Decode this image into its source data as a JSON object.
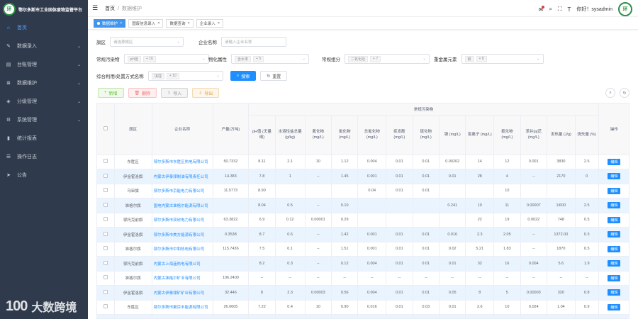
{
  "app": {
    "title": "鄂尔多斯市工业固体废物监管平台",
    "logo_text": "环",
    "watermark_logo": "100",
    "watermark_text": "大数跨境"
  },
  "sidebar": {
    "items": [
      {
        "label": "首页",
        "icon": "home-icon",
        "active": true
      },
      {
        "label": "数据录入",
        "icon": "edit-icon",
        "chevron": true
      },
      {
        "label": "台账管理",
        "icon": "ledger-icon",
        "chevron": true
      },
      {
        "label": "数据维护",
        "icon": "database-icon",
        "chevron": true
      },
      {
        "label": "分级管理",
        "icon": "layers-icon",
        "chevron": true
      },
      {
        "label": "系统管理",
        "icon": "gear-icon",
        "chevron": true
      },
      {
        "label": "统计报表",
        "icon": "bar-chart-icon"
      },
      {
        "label": "操作日志",
        "icon": "log-icon"
      },
      {
        "label": "公告",
        "icon": "send-icon"
      }
    ]
  },
  "header": {
    "breadcrumb": [
      "首页",
      "数据维护"
    ],
    "user": "你好！sysadmin",
    "avatar_text": "环"
  },
  "tags": [
    {
      "label": "数据维护",
      "active": true
    },
    {
      "label": "固废信息录入"
    },
    {
      "label": "数据查询"
    },
    {
      "label": "企业录入"
    }
  ],
  "filters": {
    "region_label": "旗区",
    "region_placeholder": "请选择旗区",
    "company_label": "企业名称",
    "company_placeholder": "请输入企业名称",
    "pollutant_label": "常规污染物",
    "pollutant_chips": [
      "pH值",
      "+ 16"
    ],
    "physchem_label": "物化属性",
    "physchem_chips": [
      "含水率",
      "+ 5"
    ],
    "conventional_label": "常规组分",
    "conventional_chips": [
      "二氧化硅",
      "+ 7"
    ],
    "heavy_label": "重金属元素",
    "heavy_chips": [
      "镉",
      "+ 8"
    ],
    "radio_label": "综合利用/处置方式名称",
    "radio_chips": [
      "填埋",
      "+ 10"
    ],
    "search_button": "搜索",
    "reset_button": "重置"
  },
  "toolbar": {
    "add": "新增",
    "delete": "删除",
    "import": "导入",
    "export": "导出"
  },
  "table": {
    "group_header": "常规污染物",
    "operation": "操作",
    "columns": [
      "旗区",
      "企业名称",
      "产量(万吨)",
      "pH值 (无量纲)",
      "水溶性盐总量 (g/kg)",
      "氟化物 (mg/L)",
      "氰化物 (mg/L)",
      "总氰化物 (mg/L)",
      "挥发酚 (mg/L)",
      "硫化物 (mg/L)",
      "镍 (mg/L)",
      "氯离子 (mg/L)",
      "氟化物 (mg/L)",
      "苯并[a]芘 (mg/L)",
      "发热量 (J/g)",
      "烧失量 (%)"
    ],
    "rows": [
      [
        "东胜区",
        "鄂尔多斯市东胜区热电有限公司",
        "50.7332",
        "8.11",
        "2.1",
        "10",
        "1.12",
        "0.004",
        "0.01",
        "0.01",
        "0.00202",
        "14",
        "12",
        "0.001",
        "3830",
        "2.5"
      ],
      [
        "伊金霍洛旗",
        "内蒙古伊泰煤制油有限责任公司",
        "14.383",
        "7.8",
        "1",
        "--",
        "1.45",
        "0.001",
        "0.01",
        "0.01",
        "0.01",
        "28",
        "4",
        "--",
        "2170",
        "0"
      ],
      [
        "乌审旗",
        "鄂尔多斯市京能电力有限公司",
        "11.5773",
        "8.90",
        "",
        "",
        "",
        "0.04",
        "0.01",
        "0.01",
        "",
        "",
        "10",
        "",
        "",
        ""
      ],
      [
        "准格尔旗",
        "国电内蒙古准格尔能源有限公司",
        "",
        "8.04",
        "0.5",
        "--",
        "0.10",
        "",
        "",
        "",
        "0.241",
        "10",
        "11",
        "0.00007",
        "1/600",
        "2.5"
      ],
      [
        "鄂托克前旗",
        "鄂尔多斯市双欣电力有限公司",
        "63.3822",
        "6.9",
        "0.12",
        "0.00001",
        "0.29",
        "",
        "",
        "",
        "",
        "22",
        "19",
        "0.0022",
        "748",
        "0.5"
      ],
      [
        "伊金霍洛旗",
        "鄂尔多斯市美方能源有限公司",
        "0.3538",
        "8.7",
        "0.6",
        "--",
        "1.42",
        "0.001",
        "0.01",
        "0.01",
        "0.016",
        "2.3",
        "2.05",
        "--",
        "1372.00",
        "0.3"
      ],
      [
        "准格尔旗",
        "鄂尔多斯市中和热电有限公司",
        "115.7436",
        "7.5",
        "0.1",
        "--",
        "1.51",
        "0.001",
        "0.01",
        "0.01",
        "0.02",
        "5.21",
        "1.83",
        "--",
        "1870",
        "0.5"
      ],
      [
        "鄂托克前旗",
        "内蒙古上海庙热电有限公司",
        "",
        "8.2",
        "0.3",
        "--",
        "0.12",
        "0.004",
        "0.01",
        "0.01",
        "0.01",
        "32",
        "16",
        "0.004",
        "5.6",
        "1.9"
      ],
      [
        "准格尔旗",
        "内蒙古准格尔矿业有限公司",
        "106.2400",
        "--",
        "--",
        "--",
        "--",
        "--",
        "--",
        "--",
        "--",
        "--",
        "--",
        "--",
        "--",
        "--"
      ],
      [
        "伊金霍洛旗",
        "内蒙古伊泰煤矿矿业有限公司",
        "32.446",
        "8",
        "2.3",
        "0.00003",
        "0.56",
        "0.004",
        "0.01",
        "0.01",
        "0.05",
        "8",
        "5",
        "0.00003",
        "320",
        "0.8"
      ],
      [
        "东胜区",
        "鄂尔多斯市聚百丰能源有限公司",
        "26.0605",
        "7.22",
        "0.4",
        "10",
        "0.90",
        "0.016",
        "0.01",
        "0.03",
        "0.01",
        "2.6",
        "10",
        "0.024",
        "1.04",
        "0.9"
      ],
      [
        "伊金霍洛旗",
        "内蒙古伊泰化工有限责任公司",
        "",
        "",
        "",
        "",
        "",
        "",
        "",
        "",
        "",
        "",
        "",
        "",
        "",
        ""
      ]
    ],
    "row_button": "编辑"
  },
  "colors": {
    "sidebar_bg": "#2f3b4c",
    "accent": "#1f8fff",
    "row_stripe": "#eaf4ff"
  }
}
